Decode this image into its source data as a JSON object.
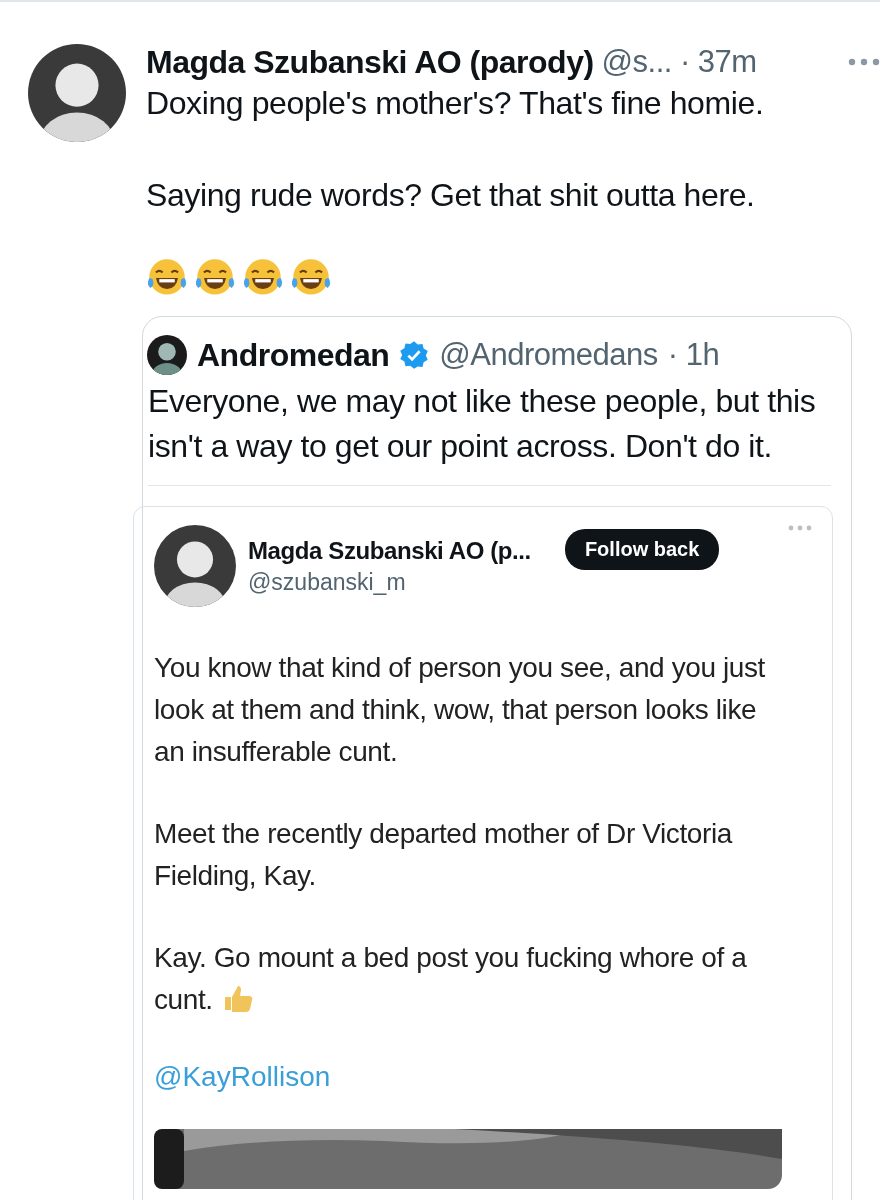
{
  "post": {
    "author": "Magda Szubanski AO (parody)",
    "handle": "@s...",
    "time": "· 37m",
    "paragraphs": [
      "Doxing people's mother's? That's fine homie.",
      "Saying rude words? Get that shit outta here."
    ],
    "emojis": [
      {
        "kind": "laughing"
      },
      {
        "kind": "laughing"
      },
      {
        "kind": "laughing"
      },
      {
        "kind": "laughing"
      }
    ],
    "quote": {
      "author": "Andromedan",
      "verified": true,
      "handle": "@Andromedans",
      "time": "· 1h",
      "text": "Everyone, we may not like these people, but this isn't a way to get our point across. Don't do it.",
      "attachment": {
        "author": "Magda Szubanski AO (p...",
        "handle": "@szubanski_m",
        "follow_button": "Follow back",
        "paragraphs": [
          {
            "text": "You know that kind of person you see, and you just look at them and think, wow, that person looks like an insufferable cunt.",
            "kind": "plain"
          },
          {
            "text": "Meet the recently departed mother of Dr Victoria Fielding, Kay.",
            "kind": "plain"
          },
          {
            "text": "Kay. Go mount a bed post you fucking whore of a cunt.",
            "kind": "thumbs_up"
          }
        ],
        "mention": "@KayRollison"
      }
    }
  }
}
